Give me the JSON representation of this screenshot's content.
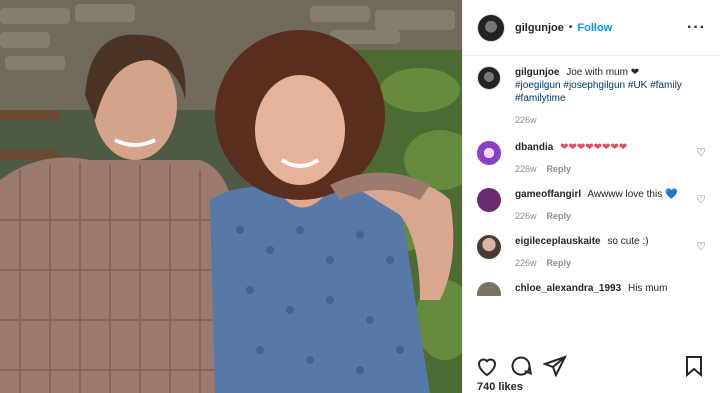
{
  "post": {
    "username": "gilgunjoe",
    "follow_label": "Follow",
    "separator": "•",
    "more_label": "···",
    "caption": {
      "username": "gilgunjoe",
      "text": " Joe with mum ❤",
      "hashtags": [
        "#joegilgun",
        "#josephgilgun",
        "#UK",
        "#family",
        "#familytime"
      ],
      "time": "226w"
    },
    "comments": [
      {
        "username": "dbandia",
        "text": "❤❤❤❤❤❤❤❤",
        "time": "226w",
        "reply_label": "Reply",
        "text_color": "#ed4956"
      },
      {
        "username": "gameoffangirl",
        "text": "Awwww love this 💙",
        "time": "226w",
        "reply_label": "Reply"
      },
      {
        "username": "eigileceplauskaite",
        "text": "so cute :)",
        "time": "226w",
        "reply_label": "Reply"
      },
      {
        "username": "chloe_alexandra_1993",
        "text": "His mum",
        "time": "",
        "reply_label": ""
      }
    ],
    "likes": "740 likes"
  },
  "icons": {
    "like": "heart-icon",
    "comment": "comment-icon",
    "share": "paper-plane-icon",
    "save": "bookmark-icon",
    "comment_like": "heart-outline-icon",
    "more": "more-options-icon"
  },
  "colors": {
    "link": "#0095f6",
    "hashtag": "#00376b",
    "muted": "#8e8e8e"
  }
}
